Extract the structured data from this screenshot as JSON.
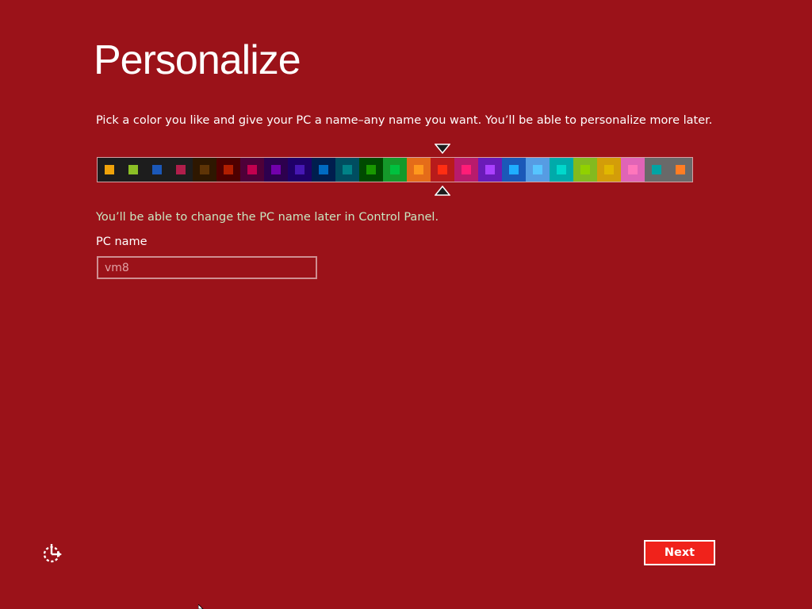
{
  "page": {
    "title": "Personalize",
    "description": "Pick a color you like and give your PC a name–any name you want. You’ll be able to personalize more later.",
    "hint": "You’ll be able to change the PC name later in Control Panel.",
    "pc_name_label": "PC name",
    "pc_name_value": "",
    "pc_name_placeholder": "vm8",
    "next_label": "Next"
  },
  "colors": {
    "background": "#9b1219",
    "next_button": "#f0221b",
    "hint_text": "#c8e6c0"
  },
  "palette": {
    "selected_index": 14,
    "swatches": [
      {
        "bg": "#1d1d1d",
        "chip": "#f0a30a"
      },
      {
        "bg": "#1d1d1d",
        "chip": "#8cbf26"
      },
      {
        "bg": "#1d1d1d",
        "chip": "#1b58b8"
      },
      {
        "bg": "#1d1d1d",
        "chip": "#b01e4b"
      },
      {
        "bg": "#2e1700",
        "chip": "#5e3406"
      },
      {
        "bg": "#4e0000",
        "chip": "#b01e00"
      },
      {
        "bg": "#4e0038",
        "chip": "#c1004f"
      },
      {
        "bg": "#2d004e",
        "chip": "#7200ac"
      },
      {
        "bg": "#1f0068",
        "chip": "#4617b4"
      },
      {
        "bg": "#001e4e",
        "chip": "#006ac1"
      },
      {
        "bg": "#004d60",
        "chip": "#008287"
      },
      {
        "bg": "#004a00",
        "chip": "#199900"
      },
      {
        "bg": "#15992a",
        "chip": "#00c13f"
      },
      {
        "bg": "#e56c19",
        "chip": "#ff981d"
      },
      {
        "bg": "#b81b1b",
        "chip": "#ff2e12"
      },
      {
        "bg": "#b81b6c",
        "chip": "#ff1d77"
      },
      {
        "bg": "#691bb8",
        "chip": "#aa40ff"
      },
      {
        "bg": "#1b58b8",
        "chip": "#1faeff"
      },
      {
        "bg": "#569ce3",
        "chip": "#56c5ff"
      },
      {
        "bg": "#00aaaa",
        "chip": "#00d8cc"
      },
      {
        "bg": "#83ba1f",
        "chip": "#91d100"
      },
      {
        "bg": "#d39d09",
        "chip": "#e1b700"
      },
      {
        "bg": "#e064b7",
        "chip": "#ff76bc"
      },
      {
        "bg": "#696969",
        "chip": "#00a4a4"
      },
      {
        "bg": "#696969",
        "chip": "#ff7d23"
      }
    ]
  },
  "icons": {
    "ease_of_access": "ease-of-access-icon",
    "selection_marker_top": "triangle-down-icon",
    "selection_marker_bottom": "triangle-up-icon"
  }
}
